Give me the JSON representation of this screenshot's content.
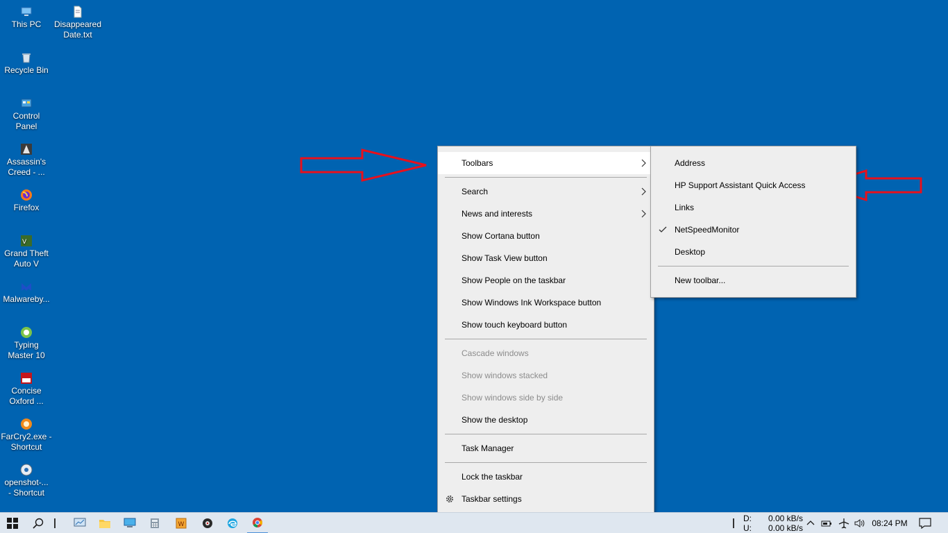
{
  "desktop": {
    "icons": [
      {
        "label": "This PC"
      },
      {
        "label": "Disappeared\nDate.txt"
      },
      {
        "label": "Recycle Bin"
      },
      {
        "label": "Control\nPanel"
      },
      {
        "label": "Assassin's\nCreed - ..."
      },
      {
        "label": "Firefox"
      },
      {
        "label": "Grand Theft\nAuto V"
      },
      {
        "label": "Malwareby..."
      },
      {
        "label": "Typing\nMaster 10"
      },
      {
        "label": "Concise\nOxford ..."
      },
      {
        "label": "FarCry2.exe -\nShortcut"
      },
      {
        "label": "openshot-...\n- Shortcut"
      }
    ]
  },
  "context_menu": {
    "items": [
      {
        "label": "Toolbars"
      },
      {
        "label": "Search"
      },
      {
        "label": "News and interests"
      },
      {
        "label": "Show Cortana button"
      },
      {
        "label": "Show Task View button"
      },
      {
        "label": "Show People on the taskbar"
      },
      {
        "label": "Show Windows Ink Workspace button"
      },
      {
        "label": "Show touch keyboard button"
      },
      {
        "label": "Cascade windows"
      },
      {
        "label": "Show windows stacked"
      },
      {
        "label": "Show windows side by side"
      },
      {
        "label": "Show the desktop"
      },
      {
        "label": "Task Manager"
      },
      {
        "label": "Lock the taskbar"
      },
      {
        "label": "Taskbar settings"
      }
    ]
  },
  "toolbars_submenu": {
    "items": [
      {
        "label": "Address"
      },
      {
        "label": "HP Support Assistant Quick Access"
      },
      {
        "label": "Links"
      },
      {
        "label": "NetSpeedMonitor",
        "checked": true
      },
      {
        "label": "Desktop"
      },
      {
        "label": "New toolbar..."
      }
    ]
  },
  "taskbar": {
    "netspeed": {
      "d_label": "D:",
      "d_value": "0.00 kB/s",
      "u_label": "U:",
      "u_value": "0.00 kB/s"
    },
    "clock": "08:24 PM"
  },
  "colors": {
    "desktop_bg": "#0063b1",
    "arrow_red": "#e8101c",
    "menu_bg": "#eeeeee"
  }
}
